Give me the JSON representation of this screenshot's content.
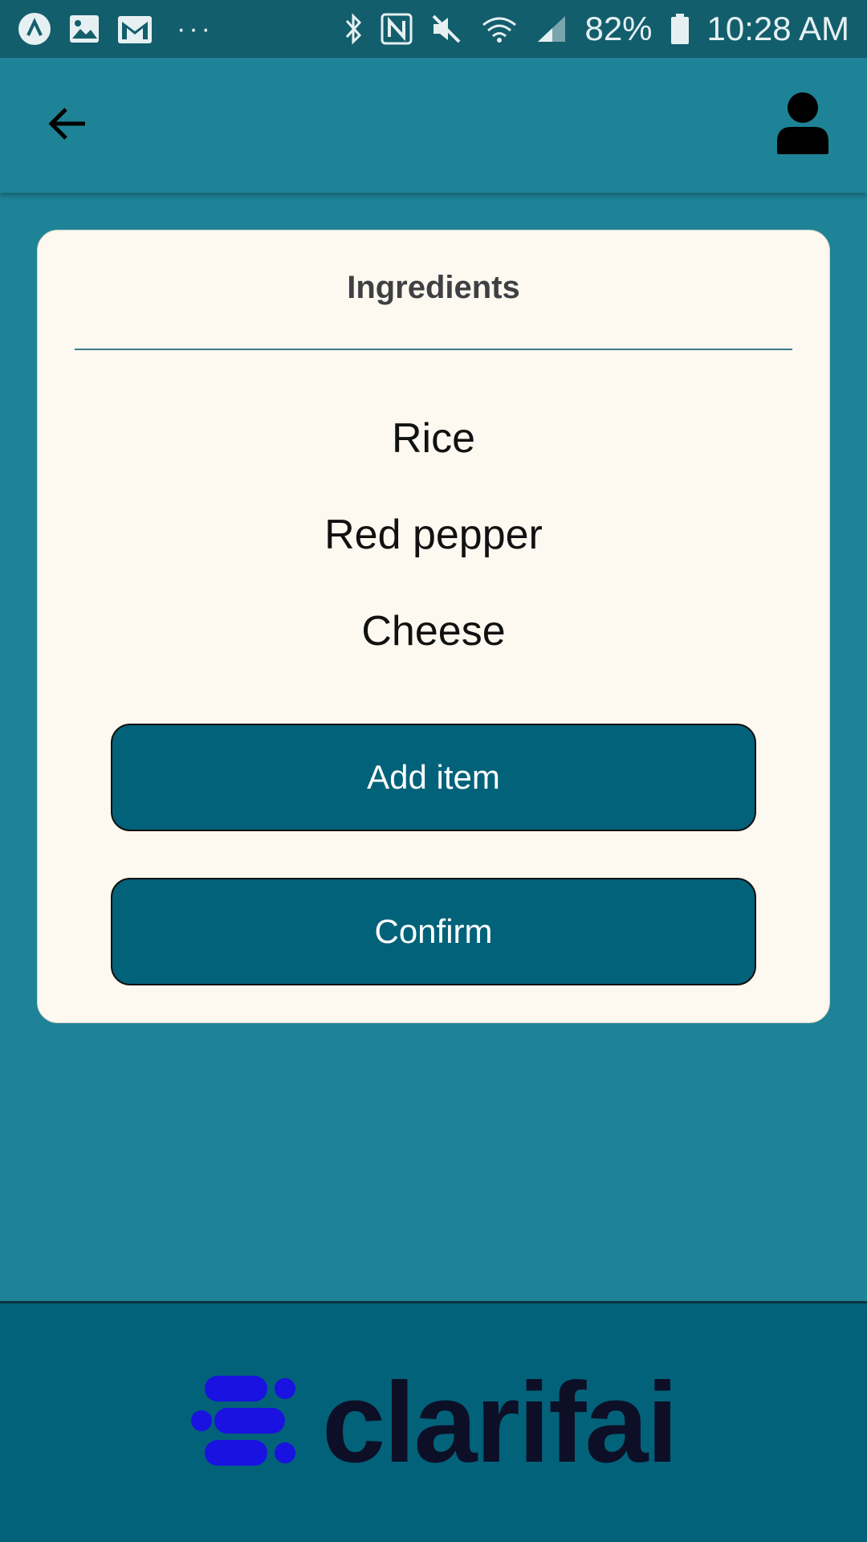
{
  "status_bar": {
    "battery": "82%",
    "time": "10:28 AM",
    "left_icons": [
      "app-icon",
      "image-icon",
      "gmail-icon",
      "more-dots-icon"
    ],
    "right_icons": [
      "bluetooth-icon",
      "nfc-icon",
      "mute-icon",
      "wifi-icon",
      "signal-icon",
      "battery-icon"
    ]
  },
  "app_bar": {
    "back_icon": "arrow-left-icon",
    "profile_icon": "user-icon"
  },
  "card": {
    "title": "Ingredients",
    "ingredients": [
      "Rice",
      "Red pepper",
      "Cheese"
    ],
    "add_button": "Add item",
    "confirm_button": "Confirm"
  },
  "footer": {
    "logo_text": "clarifai"
  },
  "colors": {
    "background": "#1e8396",
    "status_bar": "#135e6c",
    "card": "#fef9f0",
    "button": "#02627a",
    "logo_mark": "#1a12e0",
    "logo_text": "#0d0f26"
  }
}
